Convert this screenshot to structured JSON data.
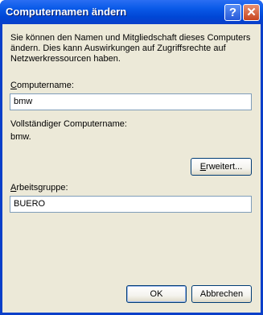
{
  "window": {
    "title": "Computernamen ändern",
    "help_label": "?",
    "close_label": "✕"
  },
  "description": [
    "Sie können den Namen und Mitgliedschaft dieses Computers",
    "ändern. Dies kann Auswirkungen auf Zugriffsrechte auf",
    "Netzwerkressourcen haben."
  ],
  "computer_name": {
    "label_access": "C",
    "label_rest": "omputername:",
    "value": "bmw"
  },
  "full_name": {
    "label": "Vollständiger Computername:",
    "value": "bmw."
  },
  "advanced_button": {
    "access": "E",
    "rest": "rweitert..."
  },
  "workgroup": {
    "label_access": "A",
    "label_rest": "rbeitsgruppe:",
    "value": "BUERO"
  },
  "buttons": {
    "ok": "OK",
    "cancel": "Abbrechen"
  }
}
